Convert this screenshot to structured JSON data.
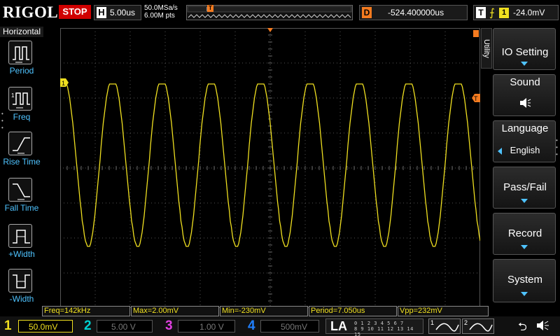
{
  "brand": "RIGOL",
  "run_status": "STOP",
  "timebase": {
    "label": "H",
    "value": "5.00us"
  },
  "acquisition": {
    "sample_rate": "50.0MSa/s",
    "memory_depth": "6.00M pts"
  },
  "delay": {
    "label": "D",
    "value": "-524.400000us"
  },
  "trigger": {
    "label": "T",
    "channel": "1",
    "level": "-24.0mV",
    "marker": "T"
  },
  "left_panel": {
    "title": "Horizontal",
    "items": [
      {
        "label": "Period",
        "icon": "period-icon"
      },
      {
        "label": "Freq",
        "icon": "frequency-icon"
      },
      {
        "label": "Rise Time",
        "icon": "rise-time-icon"
      },
      {
        "label": "Fall Time",
        "icon": "fall-time-icon"
      },
      {
        "label": "+Width",
        "icon": "positive-width-icon"
      },
      {
        "label": "-Width",
        "icon": "negative-width-icon"
      }
    ]
  },
  "right_menu": {
    "tab": "Utility",
    "items": [
      {
        "label": "IO Setting"
      },
      {
        "label": "Sound",
        "sub": "speaker-icon"
      },
      {
        "label": "Language",
        "value": "English"
      },
      {
        "label": "Pass/Fail"
      },
      {
        "label": "Record"
      },
      {
        "label": "System"
      }
    ]
  },
  "channel_marker": "1",
  "trigger_level_marker": "T",
  "measurements": [
    {
      "text": "Freq=142kHz"
    },
    {
      "text": "Max=2.00mV"
    },
    {
      "text": "Min=-230mV"
    },
    {
      "text": "Period=7.050us"
    },
    {
      "text": "Vpp=232mV"
    }
  ],
  "channels": [
    {
      "num": "1",
      "scale": "50.0mV",
      "color": "#f0e020",
      "active": true
    },
    {
      "num": "2",
      "scale": "5.00 V",
      "color": "#00d0d0",
      "active": false
    },
    {
      "num": "3",
      "scale": "1.00 V",
      "color": "#e040e0",
      "active": false
    },
    {
      "num": "4",
      "scale": "500mV",
      "color": "#2080ff",
      "active": false
    }
  ],
  "logic_analyzer": {
    "label": "LA",
    "digits_row1": "0 1 2 3   4 5 6 7",
    "digits_row2": "8 9 10 11  12 13 14 15"
  },
  "buses": [
    {
      "num": "1"
    },
    {
      "num": "2"
    }
  ],
  "colors": {
    "ch1": "#f0e020",
    "accent": "#4fc3ff",
    "trigger": "#f47b20",
    "stop": "#d00000"
  },
  "waveform": {
    "max_mv": 2.0,
    "min_mv": -230,
    "period_us": 7.05
  }
}
